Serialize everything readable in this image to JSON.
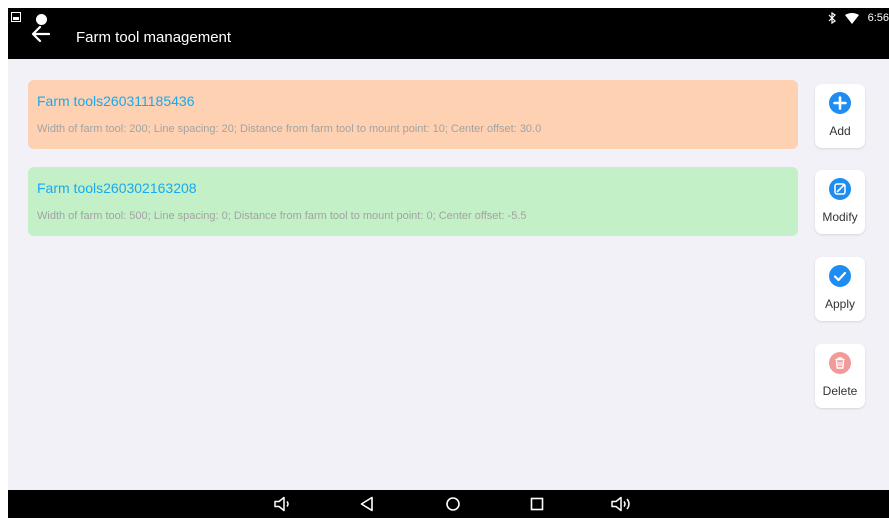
{
  "header": {
    "title": "Farm tool management",
    "time": "6:56"
  },
  "tools": [
    {
      "name": "Farm tools260311185436",
      "description": "Width of farm tool: 200; Line spacing: 20; Distance from farm tool to mount point: 10; Center offset: 30.0",
      "color": "#fdd1b1"
    },
    {
      "name": "Farm tools260302163208",
      "description": "Width of farm tool: 500; Line spacing: 0; Distance from farm tool to mount point: 0; Center offset: -5.5",
      "color": "#c3f0c6"
    }
  ],
  "actions": {
    "add": {
      "label": "Add",
      "icon": "plus-circle-icon",
      "color": "#1e8cf0"
    },
    "modify": {
      "label": "Modify",
      "icon": "edit-icon",
      "color": "#1e8cf0"
    },
    "apply": {
      "label": "Apply",
      "icon": "check-circle-icon",
      "color": "#1e8cf0"
    },
    "delete": {
      "label": "Delete",
      "icon": "trash-icon",
      "color": "#f19a9a"
    }
  },
  "navbar": {
    "icons": [
      "volume-down-icon",
      "back-icon",
      "home-icon",
      "recents-icon",
      "volume-up-icon"
    ]
  }
}
